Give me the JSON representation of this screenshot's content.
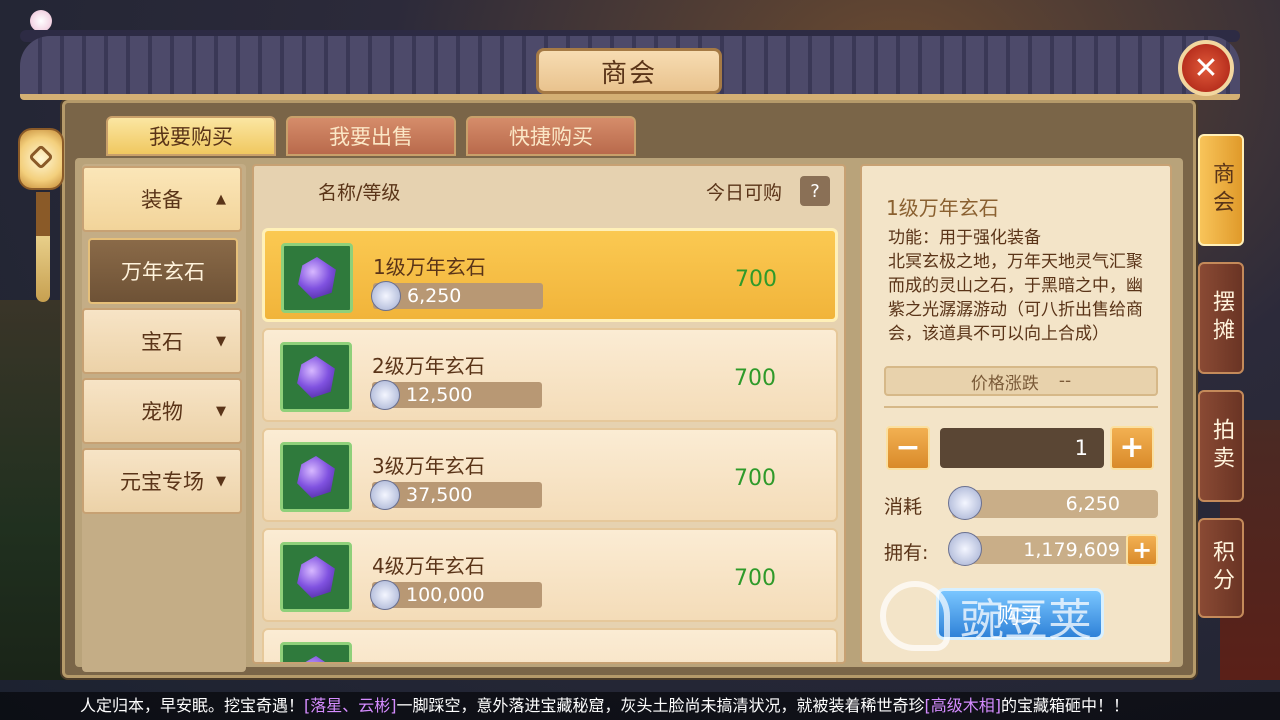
{
  "window": {
    "title": "商会",
    "close_icon": "close-icon"
  },
  "top_tabs": [
    {
      "label": "我要购买",
      "active": true
    },
    {
      "label": "我要出售",
      "active": false
    },
    {
      "label": "快捷购买",
      "active": false
    }
  ],
  "categories": [
    {
      "label": "装备",
      "arrow": "▲",
      "state": "open"
    },
    {
      "label": "万年玄石",
      "arrow": "",
      "state": "sub"
    },
    {
      "label": "宝石",
      "arrow": "▼",
      "state": "closed"
    },
    {
      "label": "宠物",
      "arrow": "▼",
      "state": "closed"
    },
    {
      "label": "元宝专场",
      "arrow": "▼",
      "state": "closed"
    }
  ],
  "list": {
    "header_name": "名称/等级",
    "header_today": "今日可购",
    "help": "?",
    "items": [
      {
        "name": "1级万年玄石",
        "price": "6,250",
        "available": "700",
        "selected": true
      },
      {
        "name": "2级万年玄石",
        "price": "12,500",
        "available": "700",
        "selected": false
      },
      {
        "name": "3级万年玄石",
        "price": "37,500",
        "available": "700",
        "selected": false
      },
      {
        "name": "4级万年玄石",
        "price": "100,000",
        "available": "700",
        "selected": false
      }
    ]
  },
  "detail": {
    "title": "1级万年玄石",
    "description": "功能：用于强化装备\n北冥玄极之地，万年天地灵气汇聚而成的灵山之石，于黑暗之中，幽紫之光潺潺游动（可八折出售给商会，该道具不可以向上合成）",
    "trend_label": "价格涨跌",
    "trend_value": "--",
    "quantity": "1",
    "minus": "−",
    "plus": "+",
    "cost_label": "消耗",
    "cost_value": "6,250",
    "own_label": "拥有:",
    "own_value": "1,179,609",
    "buy_label": "购买"
  },
  "side_tabs": [
    {
      "label": "商会",
      "active": true
    },
    {
      "label": "摆摊",
      "active": false
    },
    {
      "label": "拍卖",
      "active": false
    },
    {
      "label": "积分",
      "active": false
    }
  ],
  "news": {
    "prefix": "人定归本，早安眠。挖宝奇遇！",
    "names": "[落星、云彬]",
    "middle": "一脚踩空，意外落进宝藏秘窟，灰头土脸尚未搞清状况，就被装着稀世奇珍",
    "item": "[高级木相]",
    "suffix": "的宝藏箱砸中！！"
  },
  "watermark": "豌豆荚"
}
